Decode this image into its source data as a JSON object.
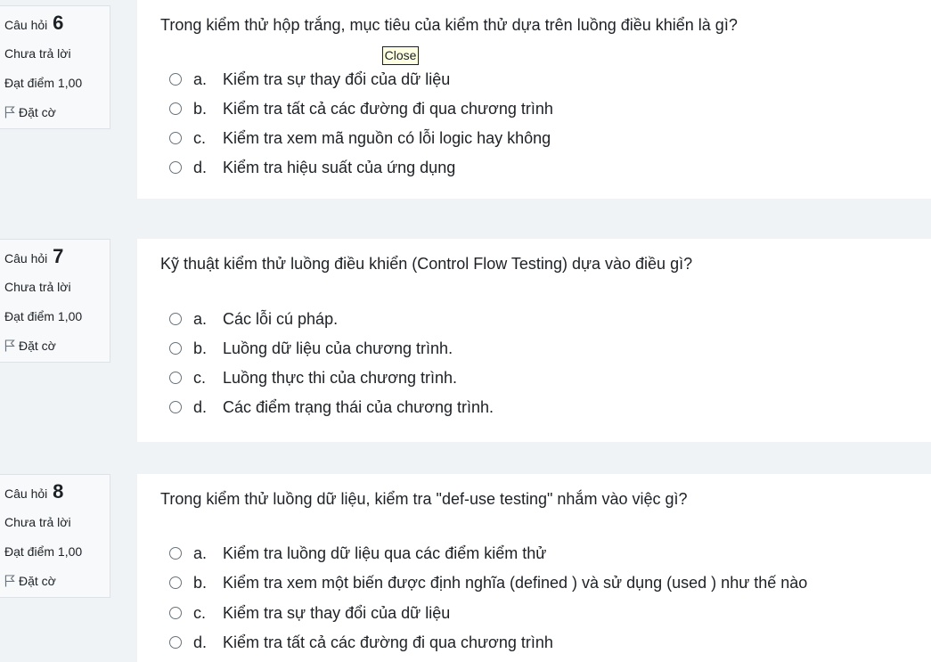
{
  "questions": [
    {
      "label": "Câu hỏi",
      "number": "6",
      "state": "Chưa trả lời",
      "grade": "Đạt điểm 1,00",
      "flag": "Đặt cờ",
      "text": "Trong kiểm thử hộp trắng, mục tiêu của kiểm thử dựa trên luồng điều khiển là gì?",
      "answers": [
        {
          "letter": "a.",
          "text": "Kiểm tra sự thay đổi của dữ liệu"
        },
        {
          "letter": "b.",
          "text": "Kiểm tra tất cả các đường đi qua chương trình"
        },
        {
          "letter": "c.",
          "text": "Kiểm tra xem mã nguồn có lỗi logic hay không"
        },
        {
          "letter": "d.",
          "text": "Kiểm tra hiệu suất của ứng dụng"
        }
      ]
    },
    {
      "label": "Câu hỏi",
      "number": "7",
      "state": "Chưa trả lời",
      "grade": "Đạt điểm 1,00",
      "flag": "Đặt cờ",
      "text": "Kỹ thuật kiểm thử luồng điều khiển (Control Flow Testing) dựa vào điều gì?",
      "answers": [
        {
          "letter": "a.",
          "text": "Các lỗi cú pháp."
        },
        {
          "letter": "b.",
          "text": "Luồng dữ liệu của chương trình."
        },
        {
          "letter": "c.",
          "text": "Luồng thực thi của chương trình."
        },
        {
          "letter": "d.",
          "text": "Các điểm trạng thái của chương trình."
        }
      ]
    },
    {
      "label": "Câu hỏi",
      "number": "8",
      "state": "Chưa trả lời",
      "grade": "Đạt điểm 1,00",
      "flag": "Đặt cờ",
      "text": "Trong kiểm thử luồng dữ liệu, kiểm tra \"def-use testing\" nhắm vào việc gì?",
      "answers": [
        {
          "letter": "a.",
          "text": "Kiểm tra luồng dữ liệu qua các điểm kiểm thử"
        },
        {
          "letter": "b.",
          "text": "Kiểm tra xem một biến được định nghĩa (defined ) và sử dụng (used ) như thế nào"
        },
        {
          "letter": "c.",
          "text": "Kiểm tra sự thay đổi của dữ liệu"
        },
        {
          "letter": "d.",
          "text": "Kiểm tra tất cả các đường đi qua chương trình"
        }
      ]
    }
  ],
  "tooltip": {
    "label": "Close"
  },
  "colors": {
    "page_bg": "#f0f3f6",
    "card_bg": "#ffffff",
    "info_bg": "#f8f9fa",
    "border": "#dee2e6",
    "text": "#1d2125",
    "tooltip_bg": "#ffffe1"
  },
  "icons": {
    "flag": "flag-icon",
    "radio": "radio-unchecked-icon"
  }
}
